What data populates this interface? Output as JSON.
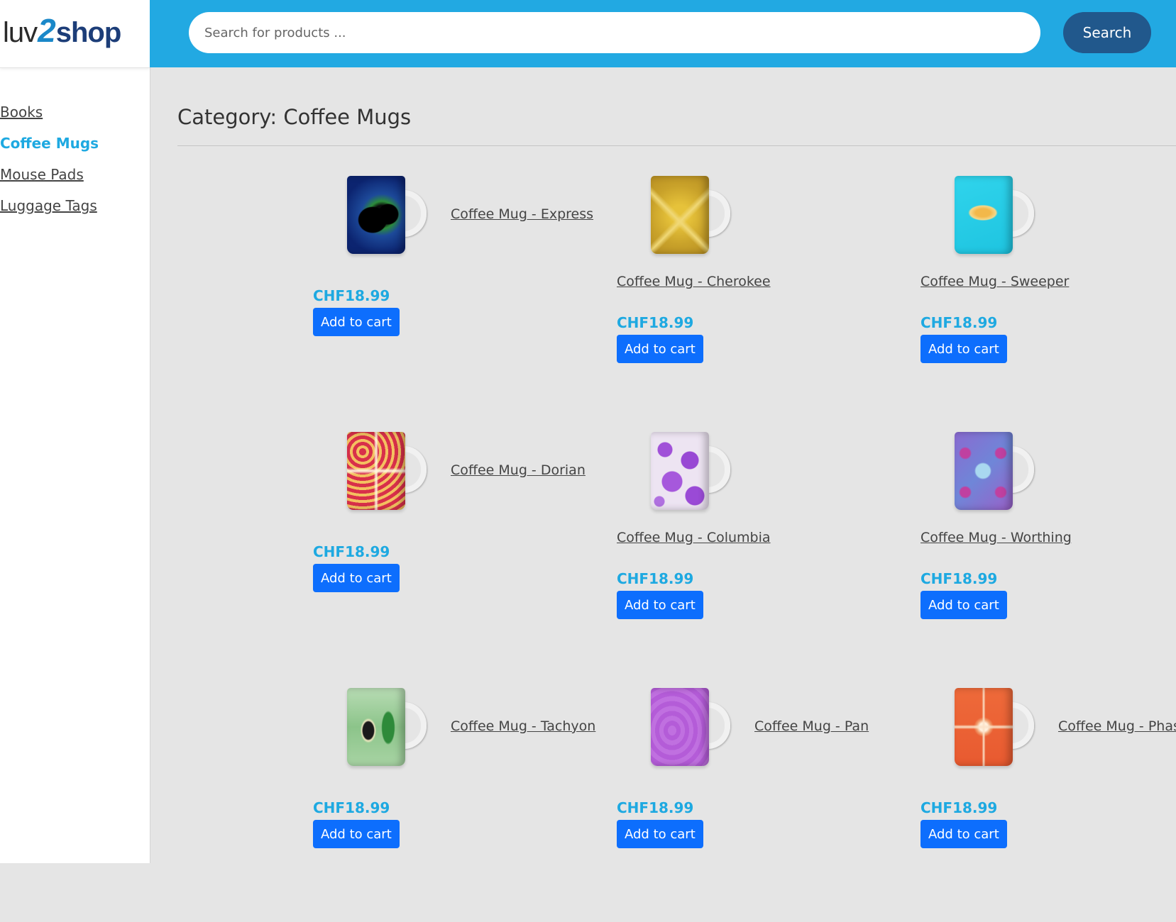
{
  "logo": {
    "part1": "luv",
    "part2": "2",
    "part3": "shop"
  },
  "search": {
    "placeholder": "Search for products ...",
    "button_label": "Search"
  },
  "categories": [
    {
      "label": "Books",
      "active": false
    },
    {
      "label": "Coffee Mugs",
      "active": true
    },
    {
      "label": "Mouse Pads",
      "active": false
    },
    {
      "label": "Luggage Tags",
      "active": false
    }
  ],
  "page": {
    "title": "Category: Coffee Mugs"
  },
  "products": [
    {
      "name": "Coffee Mug - Express",
      "price": "CHF18.99",
      "cart_label": "Add to cart",
      "mug_pattern": "express"
    },
    {
      "name": "Coffee Mug - Cherokee",
      "price": "CHF18.99",
      "cart_label": "Add to cart",
      "mug_pattern": "cherokee"
    },
    {
      "name": "Coffee Mug - Sweeper",
      "price": "CHF18.99",
      "cart_label": "Add to cart",
      "mug_pattern": "sweeper"
    },
    {
      "name": "Coffee Mug - Dorian",
      "price": "CHF18.99",
      "cart_label": "Add to cart",
      "mug_pattern": "dorian"
    },
    {
      "name": "Coffee Mug - Columbia",
      "price": "CHF18.99",
      "cart_label": "Add to cart",
      "mug_pattern": "columbia"
    },
    {
      "name": "Coffee Mug - Worthing",
      "price": "CHF18.99",
      "cart_label": "Add to cart",
      "mug_pattern": "worthing"
    },
    {
      "name": "Coffee Mug - Tachyon",
      "price": "CHF18.99",
      "cart_label": "Add to cart",
      "mug_pattern": "tachyon"
    },
    {
      "name": "Coffee Mug - Pan",
      "price": "CHF18.99",
      "cart_label": "Add to cart",
      "mug_pattern": "pan"
    },
    {
      "name": "Coffee Mug - Phas",
      "price": "CHF18.99",
      "cart_label": "Add to cart",
      "mug_pattern": "phaser"
    }
  ],
  "colors": {
    "header": "#22a9e2",
    "search_button": "#21588c",
    "price": "#1ea9e1",
    "cart_button": "#0d6efd",
    "active_category": "#1ea9e1"
  }
}
